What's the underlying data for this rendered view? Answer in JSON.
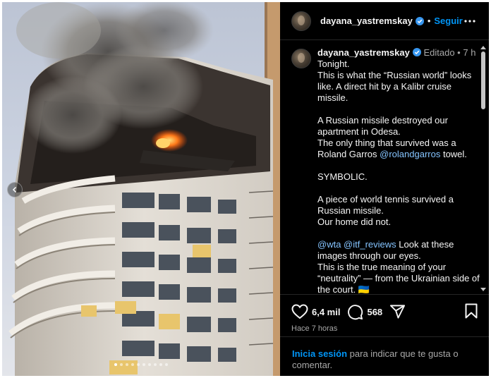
{
  "post": {
    "username": "dayana_yastremskay",
    "follow_label": "Seguir",
    "edited_label": "Editado",
    "age_short": "7 h"
  },
  "caption": {
    "lines": [
      {
        "pre": "Tonight.",
        "mention": "",
        "post": ""
      },
      {
        "pre": "This is what the “Russian world” looks like. A direct hit by a Kalibr cruise missile.",
        "mention": "",
        "post": ""
      },
      {
        "pre": "",
        "mention": "",
        "post": ""
      },
      {
        "pre": "A Russian missile destroyed our apartment in Odesa.",
        "mention": "",
        "post": ""
      },
      {
        "pre": "The only thing that survived was a Roland Garros ",
        "mention": "@rolandgarros",
        "post": " towel."
      },
      {
        "pre": "",
        "mention": "",
        "post": ""
      },
      {
        "pre": "SYMBOLIC.",
        "mention": "",
        "post": ""
      },
      {
        "pre": "",
        "mention": "",
        "post": ""
      },
      {
        "pre": "A piece of world tennis survived a Russian missile.",
        "mention": "",
        "post": ""
      },
      {
        "pre": "Our home did not.",
        "mention": "",
        "post": ""
      },
      {
        "pre": "",
        "mention": "",
        "post": ""
      },
      {
        "pre": "",
        "mention": "@wta @itf_reviews",
        "post": " Look at these images through our eyes."
      },
      {
        "pre": "This is the true meaning of your “neutrality” — from the Ukrainian side of the court. 🇺🇦",
        "mention": "",
        "post": ""
      }
    ]
  },
  "actions": {
    "likes": "6,4 mil",
    "comments": "568"
  },
  "timestamp": "Hace 7 horas",
  "login": {
    "link": "Inicia sesión",
    "rest": " para indicar que te gusta o comentar."
  },
  "carousel": {
    "total": 10,
    "active_index": 0
  },
  "icons": {
    "verified": "verified-badge-icon",
    "more": "more-options-icon",
    "like": "heart-icon",
    "comment": "comment-bubble-icon",
    "share": "share-paper-plane-icon",
    "save": "bookmark-icon",
    "prev": "chevron-left-icon"
  },
  "colors": {
    "accent": "#0095f6",
    "verified": "#3897f0",
    "background": "#000000",
    "muted": "#a8a8a8",
    "mention": "#85c4ff"
  }
}
